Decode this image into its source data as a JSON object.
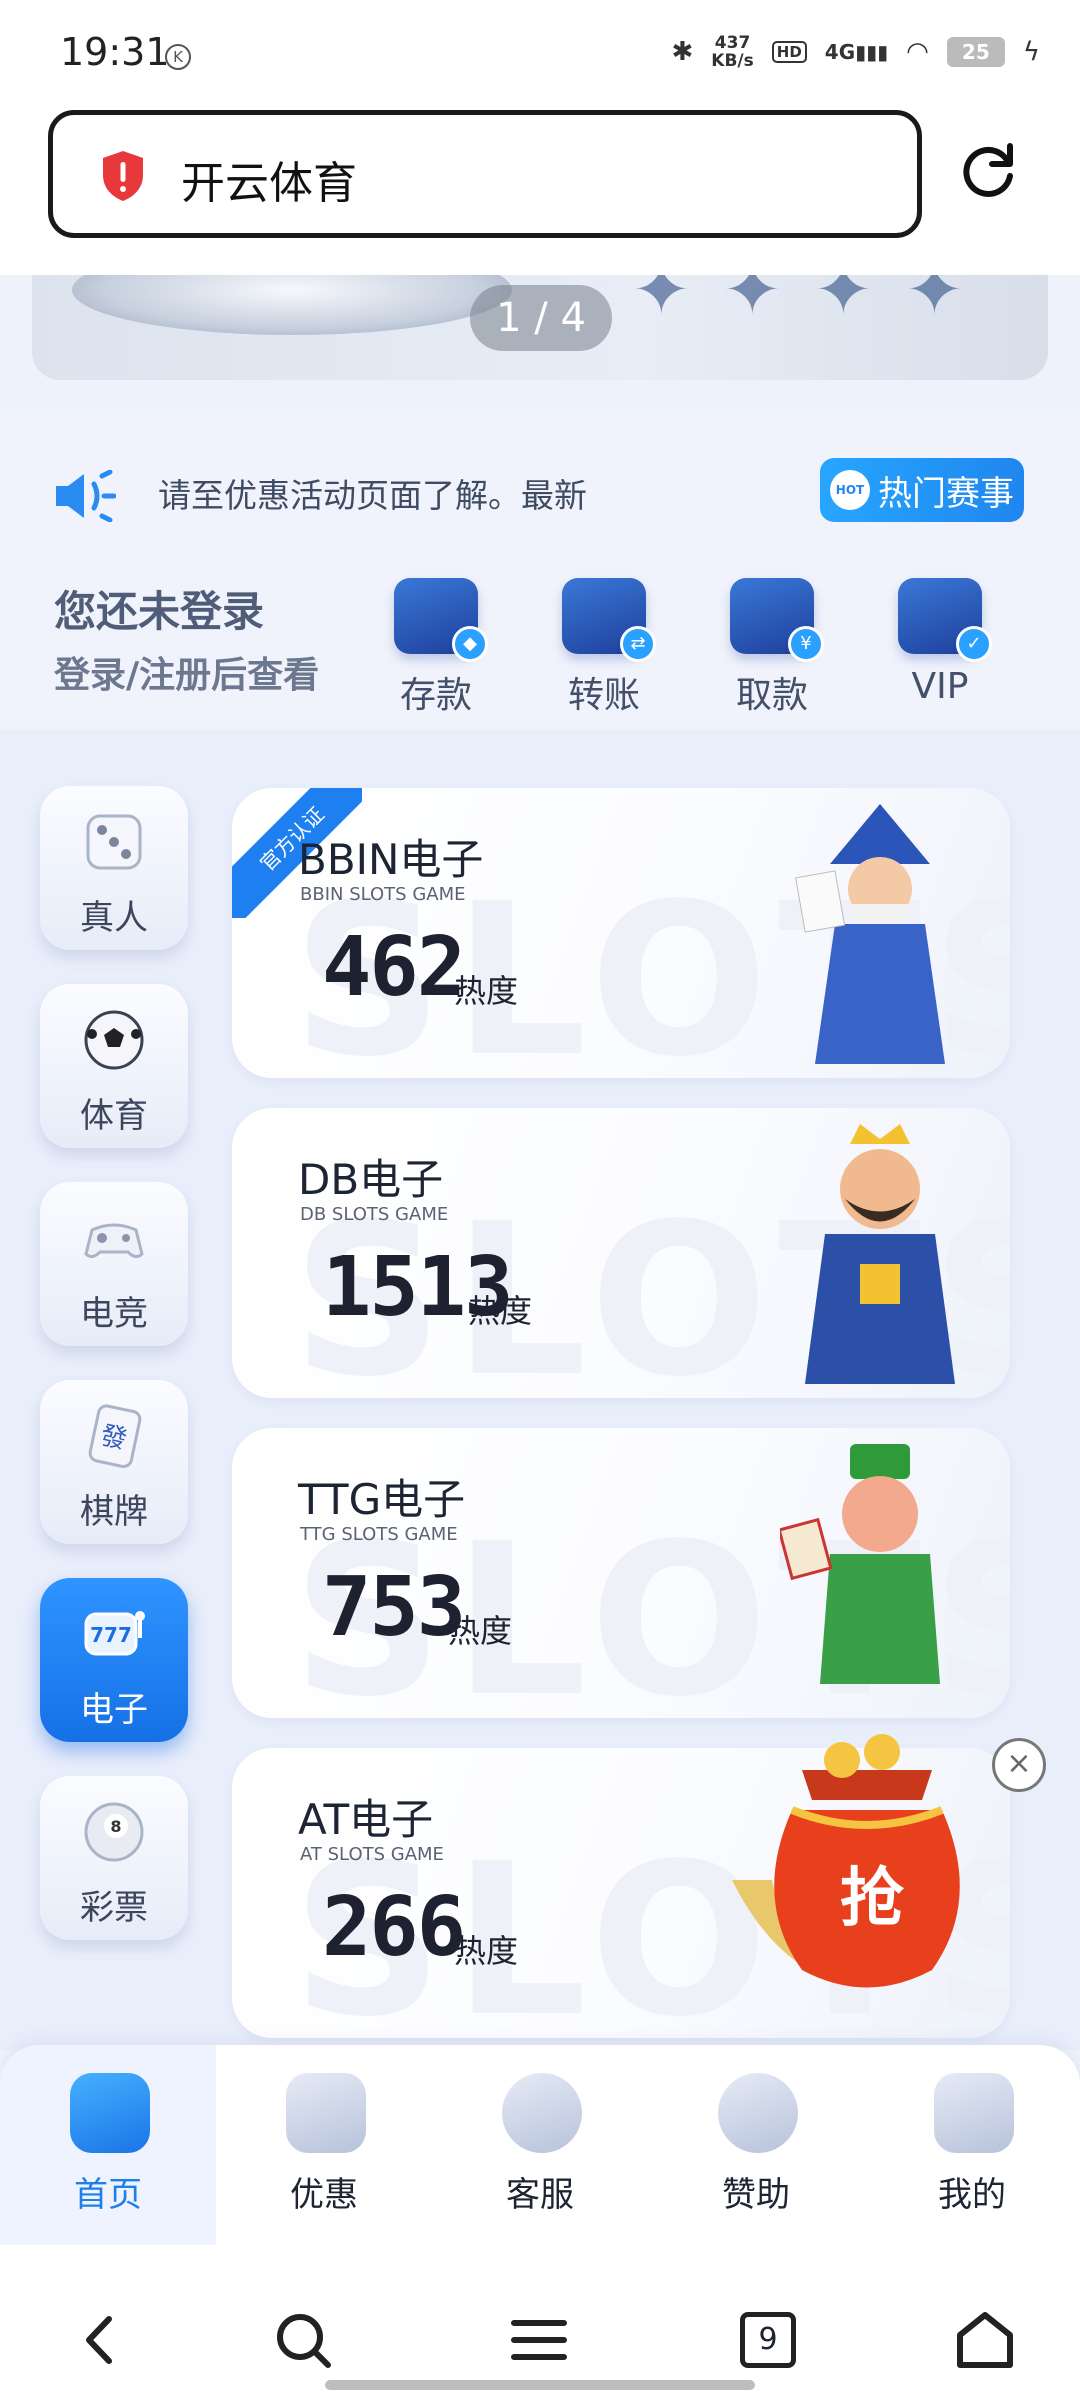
{
  "status_bar": {
    "time": "19:31",
    "k_badge": "K",
    "speed_value": "437",
    "speed_unit": "KB/s",
    "hd": "HD",
    "network": "4G",
    "battery": "25"
  },
  "browser": {
    "site_name": "开云体育",
    "icons": {
      "shield": "shield-warning-icon",
      "reload": "reload-icon"
    }
  },
  "banner": {
    "pager": "1 / 4"
  },
  "notice": {
    "marquee_text": "请至优惠活动页面了解。最新",
    "hot_button": "热门赛事",
    "hot_badge": "HOT"
  },
  "login": {
    "title": "您还未登录",
    "subtitle": "登录/注册后查看",
    "actions": [
      {
        "label": "存款",
        "icon": "wallet-icon"
      },
      {
        "label": "转账",
        "icon": "transfer-icon"
      },
      {
        "label": "取款",
        "icon": "card-icon"
      },
      {
        "label": "VIP",
        "icon": "vip-shield-icon"
      }
    ]
  },
  "categories": [
    {
      "label": "真人",
      "icon": "dice-icon"
    },
    {
      "label": "体育",
      "icon": "soccer-ball-icon"
    },
    {
      "label": "电竞",
      "icon": "gamepad-icon"
    },
    {
      "label": "棋牌",
      "icon": "mahjong-tile-icon"
    },
    {
      "label": "电子",
      "icon": "slot-machine-icon"
    },
    {
      "label": "彩票",
      "icon": "billiard-ball-icon"
    }
  ],
  "active_category": "电子",
  "cards": [
    {
      "title": "BBIN电子",
      "subtitle": "BBIN SLOTS GAME",
      "heat": "462",
      "heat_label": "热度",
      "ribbon": "官方认证",
      "watermark": "SLOTS GA"
    },
    {
      "title": "DB电子",
      "subtitle": "DB SLOTS GAME",
      "heat": "1513",
      "heat_label": "热度",
      "watermark": "SLOTS GA"
    },
    {
      "title": "TTG电子",
      "subtitle": "TTG SLOTS GAME",
      "heat": "753",
      "heat_label": "热度",
      "watermark": "SLOTS GA"
    },
    {
      "title": "AT电子",
      "subtitle": "AT SLOTS GAME",
      "heat": "266",
      "heat_label": "热度",
      "watermark": "SLOTS GA"
    }
  ],
  "promo": {
    "label": "抢",
    "close": "×"
  },
  "tabs": [
    {
      "label": "首页",
      "icon": "home-icon"
    },
    {
      "label": "优惠",
      "icon": "gift-icon"
    },
    {
      "label": "客服",
      "icon": "headset-icon"
    },
    {
      "label": "赞助",
      "icon": "medal-icon"
    },
    {
      "label": "我的",
      "icon": "profile-icon"
    }
  ],
  "navbar": {
    "tabs_count": "9"
  },
  "colors": {
    "accent": "#1f7fe8",
    "background": "#e9eefb",
    "text": "#1f2433"
  }
}
